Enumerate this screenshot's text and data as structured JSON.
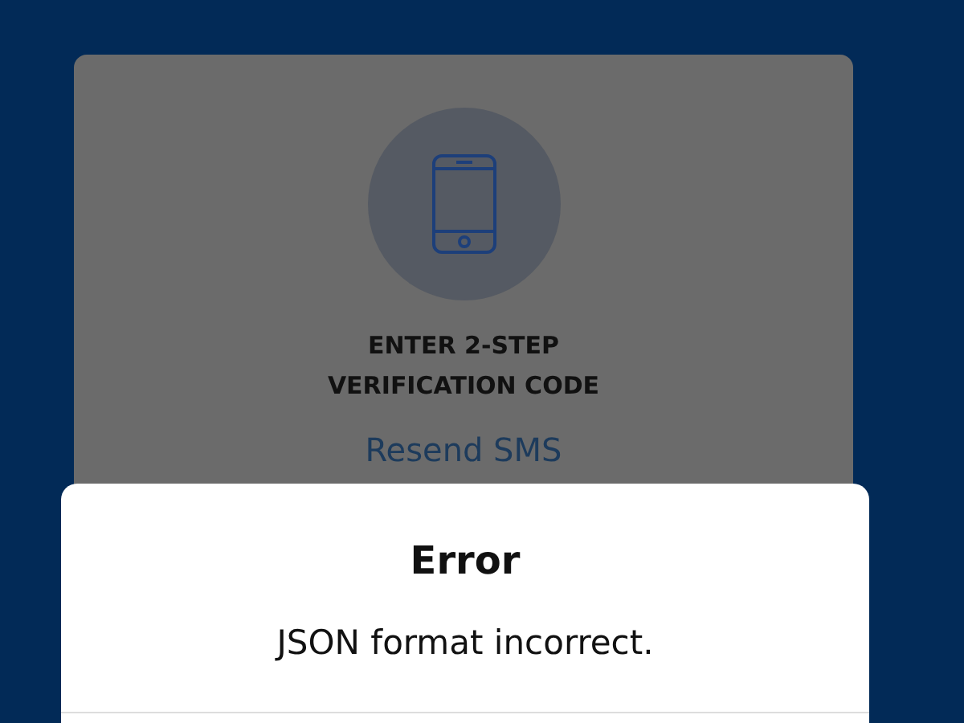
{
  "screen": {
    "title": "ENTER 2-STEP VERIFICATION CODE",
    "resend_link": "Resend SMS"
  },
  "dialog": {
    "title": "Error",
    "message": "JSON format incorrect."
  }
}
